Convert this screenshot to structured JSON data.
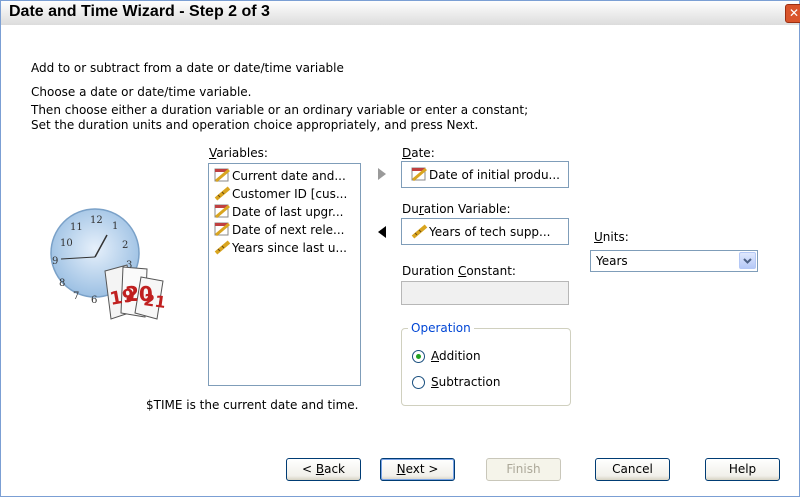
{
  "window": {
    "title": "Date and Time Wizard - Step 2 of 3",
    "close_glyph": "✕"
  },
  "instructions": {
    "line1": "Add to or subtract from a date or date/time variable",
    "line2": "Choose a date or date/time variable.",
    "line3": "Then choose either a duration variable or an ordinary variable or enter a constant;",
    "line4": "Set the duration units and operation choice appropriately, and press Next."
  },
  "variables": {
    "label_pre": "",
    "label_ul": "V",
    "label_post": "ariables:",
    "items": [
      {
        "label": "Current date and...",
        "icon": "date-variable-icon"
      },
      {
        "label": "Customer ID [cus...",
        "icon": "scale-variable-icon"
      },
      {
        "label": "Date of last upgr...",
        "icon": "date-variable-icon"
      },
      {
        "label": "Date of next rele...",
        "icon": "date-variable-icon"
      },
      {
        "label": "Years since last u...",
        "icon": "scale-variable-icon"
      }
    ]
  },
  "date": {
    "label_pre": "",
    "label_ul": "D",
    "label_post": "ate:",
    "value": "Date of initial produ..."
  },
  "duration_variable": {
    "label_pre": "Du",
    "label_ul": "r",
    "label_post": "ation Variable:",
    "value": "Years of tech supp..."
  },
  "duration_constant": {
    "label_pre": "Duration ",
    "label_ul": "C",
    "label_post": "onstant:",
    "value": ""
  },
  "units": {
    "label_pre": "",
    "label_ul": "U",
    "label_post": "nits:",
    "value": "Years"
  },
  "operation": {
    "title": "Operation",
    "addition": {
      "pre": "",
      "ul": "A",
      "post": "ddition",
      "selected": true
    },
    "subtraction": {
      "pre": "",
      "ul": "S",
      "post": "ubtraction",
      "selected": false
    }
  },
  "time_note": "$TIME is the current date and time.",
  "buttons": {
    "back": {
      "pre": "< ",
      "ul": "B",
      "post": "ack"
    },
    "next": {
      "pre": "",
      "ul": "N",
      "post": "ext >"
    },
    "finish": "Finish",
    "cancel": "Cancel",
    "help": "Help"
  },
  "colors": {
    "accent": "#0046d5",
    "title_bar": "#e6e6e6",
    "close": "#d9542b",
    "radio_dot": "#21a121"
  }
}
